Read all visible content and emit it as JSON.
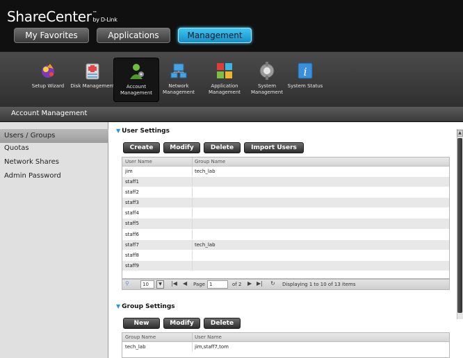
{
  "header": {
    "brand": "ShareCenter",
    "brand_tm": "™",
    "brand_by": "by D-Link",
    "nav_tabs": [
      {
        "label": "My Favorites"
      },
      {
        "label": "Applications"
      },
      {
        "label": "Management"
      }
    ],
    "active_tab": "Management"
  },
  "toolbar": {
    "items": [
      {
        "label": "Setup Wizard",
        "icon": "wizard-icon"
      },
      {
        "label": "Disk Management",
        "icon": "disk-icon"
      },
      {
        "label": "Account Management",
        "icon": "account-icon"
      },
      {
        "label": "Network Management",
        "icon": "network-icon"
      },
      {
        "label": "Application Management",
        "icon": "application-icon"
      },
      {
        "label": "System Management",
        "icon": "system-icon"
      },
      {
        "label": "System Status",
        "icon": "info-icon"
      }
    ],
    "active": "Account Management"
  },
  "section": {
    "title": "Account Management"
  },
  "sidebar": {
    "items": [
      {
        "label": "Users / Groups"
      },
      {
        "label": "Quotas"
      },
      {
        "label": "Network Shares"
      },
      {
        "label": "Admin Password"
      }
    ],
    "active": "Users / Groups"
  },
  "user_settings": {
    "title": "User Settings",
    "buttons": [
      "Create",
      "Modify",
      "Delete",
      "Import Users"
    ],
    "columns": [
      "User Name",
      "Group Name"
    ],
    "rows": [
      [
        "jim",
        "tech_lab"
      ],
      [
        "staff1",
        ""
      ],
      [
        "staff2",
        ""
      ],
      [
        "staff3",
        ""
      ],
      [
        "staff4",
        ""
      ],
      [
        "staff5",
        ""
      ],
      [
        "staff6",
        ""
      ],
      [
        "staff7",
        "tech_lab"
      ],
      [
        "staff8",
        ""
      ],
      [
        "staff9",
        ""
      ]
    ],
    "pager": {
      "page_size": "10",
      "page_label": "Page",
      "page": "1",
      "of_label": "of 2",
      "displaying": "Displaying 1 to 10 of 13 items"
    }
  },
  "group_settings": {
    "title": "Group Settings",
    "buttons": [
      "New",
      "Modify",
      "Delete"
    ],
    "columns": [
      "Group Name",
      "User Name"
    ],
    "rows": [
      [
        "tech_lab",
        "jim,staff7,tom"
      ]
    ]
  },
  "colors": {
    "accent": "#27a9e1",
    "header_bg": "#101010",
    "toolbar_bg": "#3a3a3a"
  }
}
